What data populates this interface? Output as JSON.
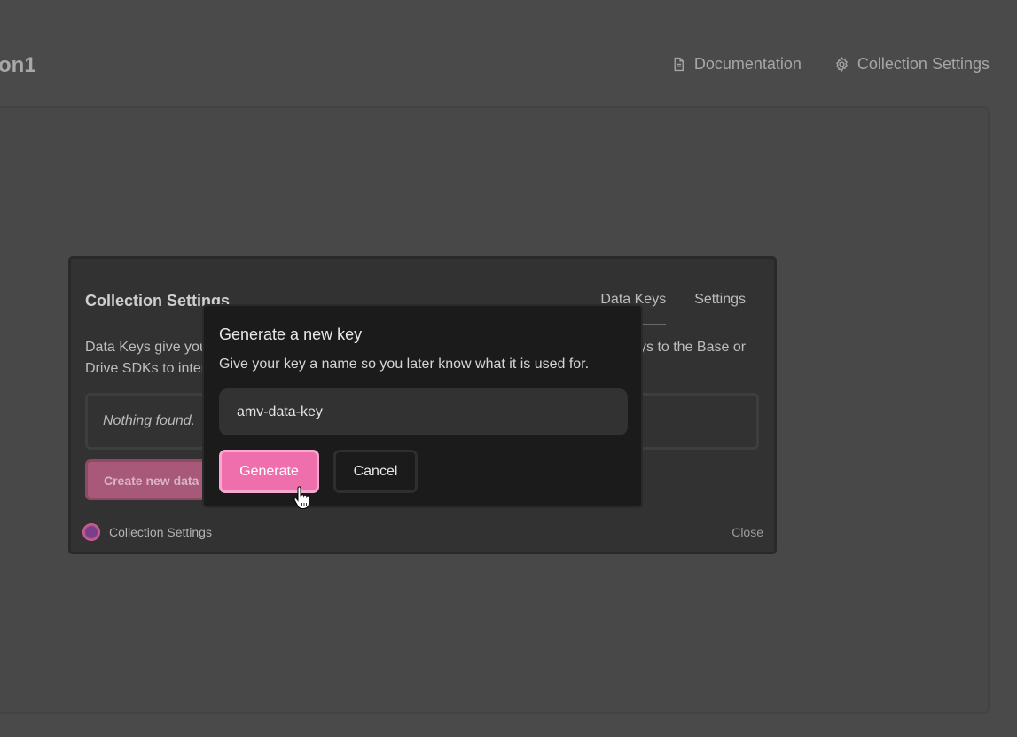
{
  "header": {
    "title": "on1",
    "links": [
      {
        "label": "Documentation",
        "icon": "document-icon"
      },
      {
        "label": "Collection Settings",
        "icon": "gear-icon"
      }
    ]
  },
  "settings_modal": {
    "title": "Collection Settings",
    "tabs": [
      {
        "label": "Data Keys",
        "active": true
      },
      {
        "label": "Settings",
        "active": false
      }
    ],
    "description_line1_left": "Data Keys give you",
    "description_line1_right": "ys to the Base or",
    "description_line2_left": "Drive SDKs to inter",
    "empty_state": "Nothing found.",
    "create_button": "Create new data key",
    "footer_label": "Collection Settings",
    "close_label": "Close"
  },
  "generate_modal": {
    "title": "Generate a new key",
    "subtitle": "Give your key a name so you later know what it is used for.",
    "input_value": "amv-data-key",
    "generate_label": "Generate",
    "cancel_label": "Cancel"
  },
  "colors": {
    "accent": "#ef6fad",
    "accent_border": "#f8a8cf",
    "backdrop": "#4a4a4a"
  }
}
